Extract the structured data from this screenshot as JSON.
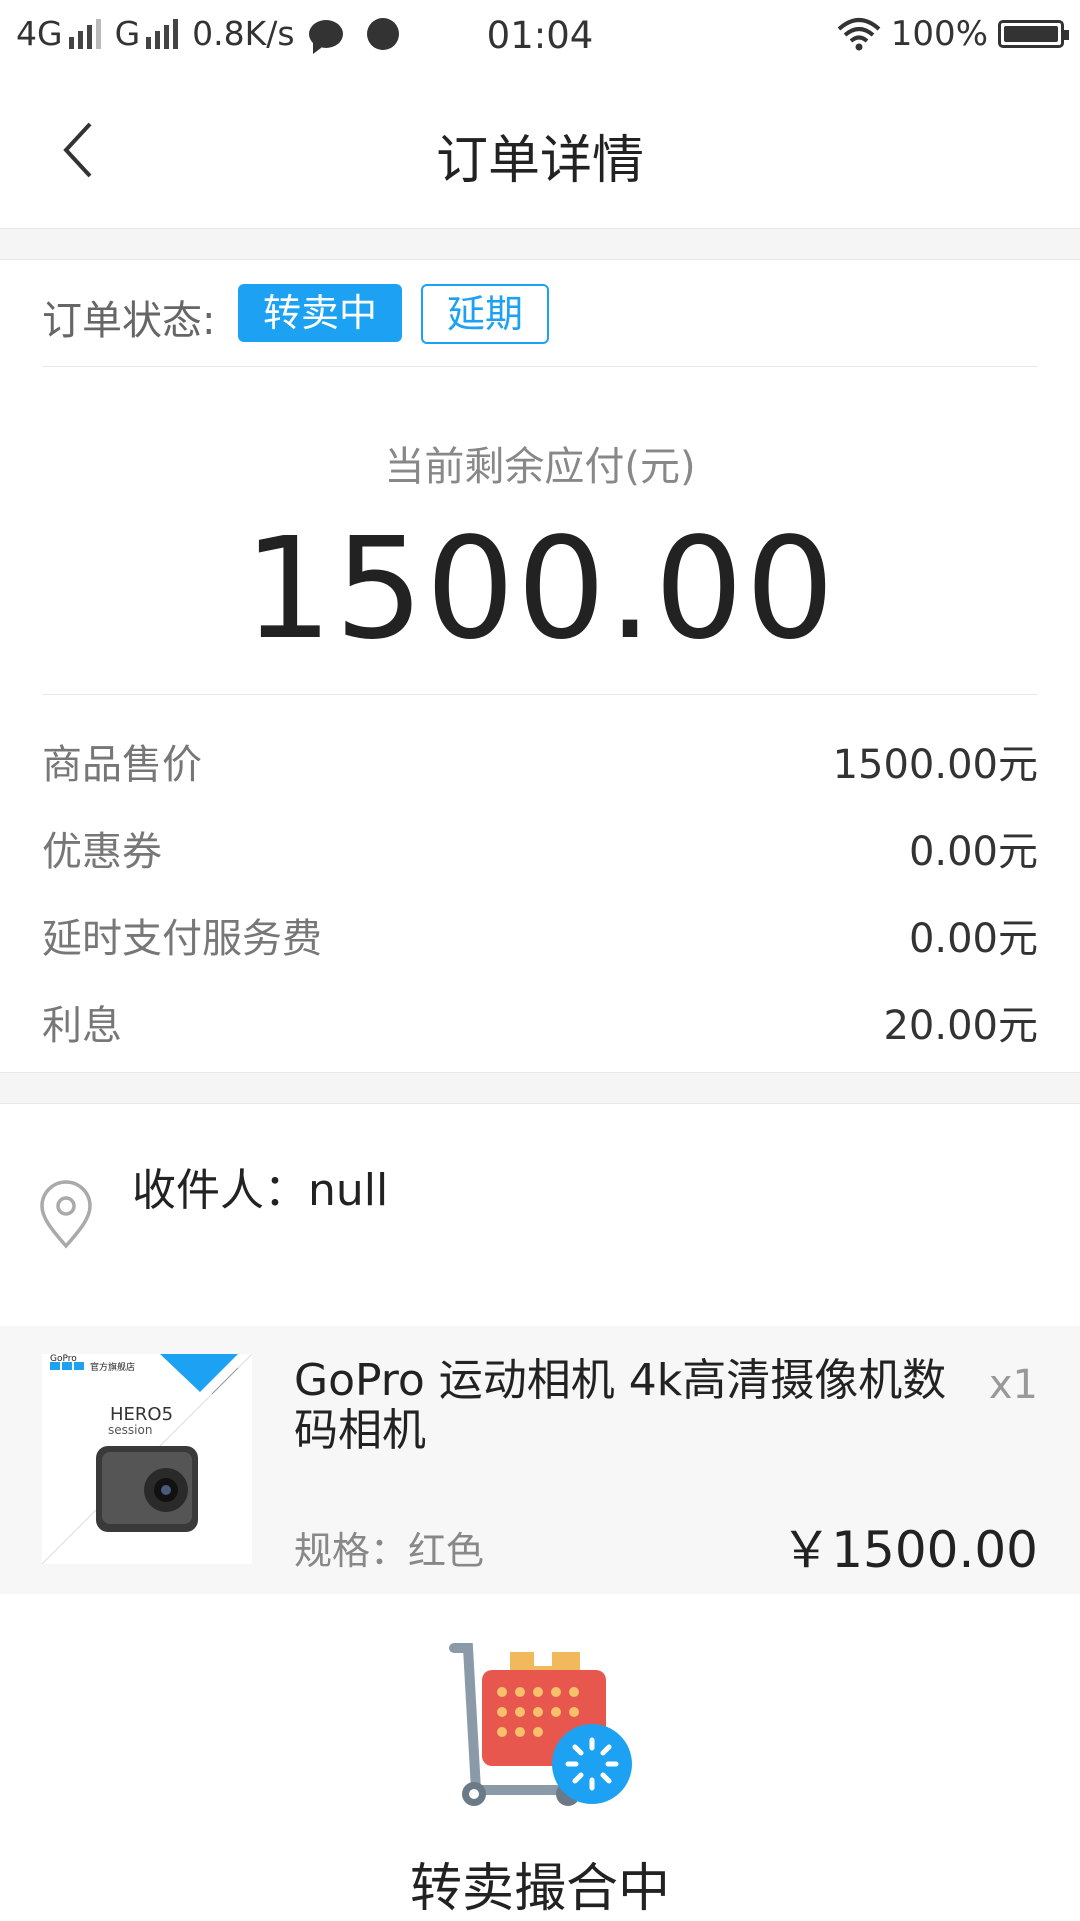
{
  "status_bar": {
    "network_1": "4G",
    "network_2": "G",
    "speed": "0.8K/s",
    "time": "01:04",
    "battery": "100%"
  },
  "nav": {
    "title": "订单详情"
  },
  "order": {
    "status_label": "订单状态:",
    "status_tag": "转卖中",
    "extend_tag": "延期"
  },
  "remaining": {
    "label": "当前剩余应付(元)",
    "amount": "1500.00"
  },
  "fees": [
    {
      "label": "商品售价",
      "value": "1500.00元"
    },
    {
      "label": "优惠券",
      "value": "0.00元"
    },
    {
      "label": "延时支付服务费",
      "value": "0.00元"
    },
    {
      "label": "利息",
      "value": "20.00元"
    }
  ],
  "address": {
    "recipient": "收件人：null"
  },
  "product": {
    "title": "GoPro 运动相机 4k高清摄像机数码相机",
    "quantity": "x1",
    "spec": "规格：红色",
    "price": "￥1500.00",
    "thumb_brand": "GoPro",
    "thumb_store": "官方旗舰店",
    "thumb_model": "HERO5",
    "thumb_sub": "session"
  },
  "footer": {
    "matching_text": "转卖撮合中"
  },
  "colors": {
    "accent": "#1da1f2",
    "cart_red": "#e8574d",
    "cart_box": "#f2b85c"
  }
}
